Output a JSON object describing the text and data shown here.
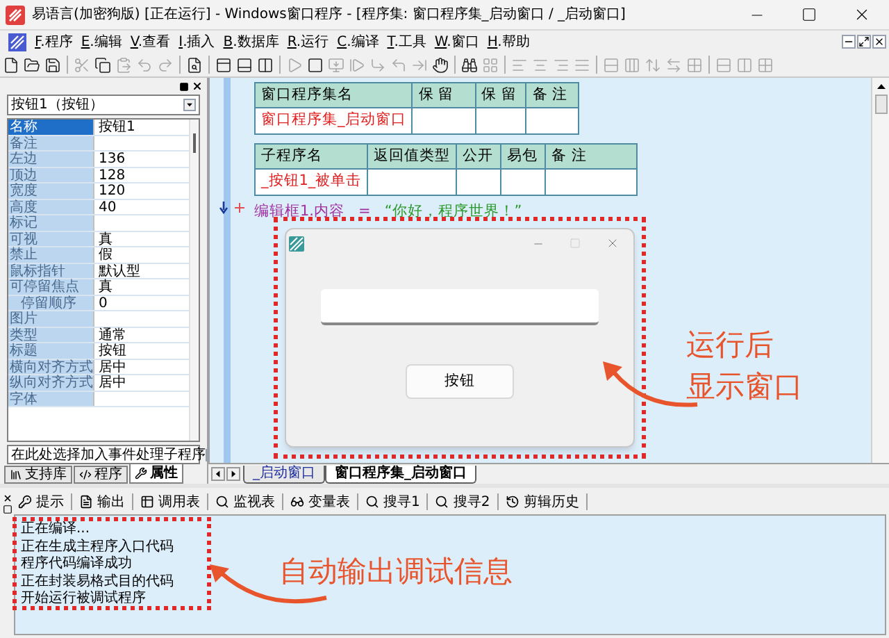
{
  "window": {
    "title": "易语言(加密狗版) [正在运行] - Windows窗口程序 - [程序集: 窗口程序集_启动窗口 / _启动窗口]"
  },
  "menu": {
    "items": [
      "F.程序",
      "E.编辑",
      "V.查看",
      "I.插入",
      "B.数据库",
      "R.运行",
      "C.编译",
      "T.工具",
      "W.窗口",
      "H.帮助"
    ]
  },
  "properties": {
    "object": "按钮1（按钮）",
    "rows": [
      {
        "name": "名称",
        "value": "按钮1",
        "selected": true
      },
      {
        "name": "备注",
        "selected": false
      },
      {
        "name": "左边",
        "value": "136",
        "selected": false
      },
      {
        "name": "顶边",
        "value": "128",
        "selected": false
      },
      {
        "name": "宽度",
        "value": "120",
        "selected": false
      },
      {
        "name": "高度",
        "value": "40",
        "selected": false
      },
      {
        "name": "标记",
        "selected": false
      },
      {
        "name": "可视",
        "value": "真",
        "selected": false
      },
      {
        "name": "禁止",
        "value": "假",
        "selected": false
      },
      {
        "name": "鼠标指针",
        "value": "默认型",
        "selected": false
      },
      {
        "name": "可停留焦点",
        "value": "真",
        "selected": false,
        "children": [
          {
            "name": "停留顺序",
            "value": "0",
            "selected": false
          }
        ]
      },
      {
        "name": "图片",
        "selected": false
      },
      {
        "name": "类型",
        "value": "通常",
        "selected": false
      },
      {
        "name": "标题",
        "value": "按钮",
        "selected": false
      },
      {
        "name": "横向对齐方式",
        "value": "居中",
        "selected": false
      },
      {
        "name": "纵向对齐方式",
        "value": "居中",
        "selected": false
      },
      {
        "name": "字体",
        "selected": false
      }
    ],
    "event_select": "在此处选择加入事件处理子程序",
    "tabs": [
      {
        "label": "支持库",
        "selected": false
      },
      {
        "label": "程序",
        "selected": false
      },
      {
        "label": "属性",
        "selected": true
      }
    ]
  },
  "editor": {
    "assembly_table": {
      "columns": [
        "窗口程序集名",
        "保 留",
        "保 留",
        "备 注"
      ],
      "name": "窗口程序集_启动窗口"
    },
    "sub_table": {
      "columns": [
        "子程序名",
        "返回值类型",
        "公开",
        "易包",
        "备 注"
      ],
      "name": "_按钮1_被单击"
    },
    "code": {
      "target": "编辑框1.内容",
      "operator": "=",
      "value": "“你好，程序世界！”"
    },
    "annotation": [
      "运行后",
      "显示窗口"
    ],
    "tabs": [
      {
        "label": "_启动窗口",
        "selected": false
      },
      {
        "label": "窗口程序集_启动窗口",
        "selected": true
      }
    ]
  },
  "running_window": {
    "button": "按钮"
  },
  "output_panel": {
    "tabs": [
      "提示",
      "输出",
      "调用表",
      "监视表",
      "变量表",
      "搜寻1",
      "搜寻2",
      "剪辑历史"
    ],
    "lines": [
      "正在编译...",
      "正在生成主程序入口代码",
      "程序代码编译成功",
      "正在封装易格式目的代码",
      "开始运行被调试程序"
    ],
    "annotation": "自动输出调试信息"
  }
}
